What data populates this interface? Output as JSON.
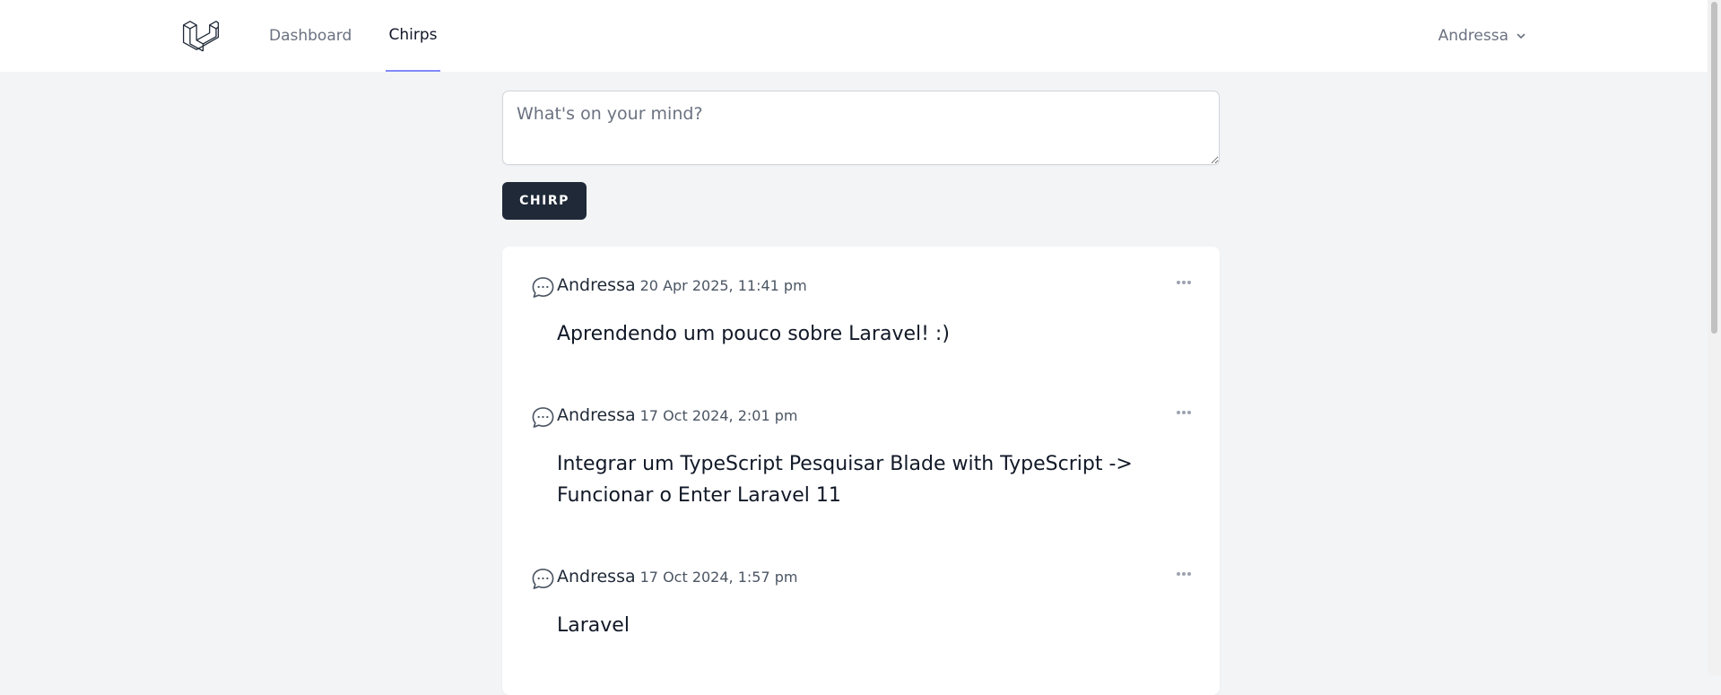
{
  "nav": {
    "links": [
      {
        "label": "Dashboard",
        "active": false
      },
      {
        "label": "Chirps",
        "active": true
      }
    ],
    "user_name": "Andressa"
  },
  "composer": {
    "placeholder": "What's on your mind?",
    "value": "",
    "button_label": "CHIRP"
  },
  "chirps": [
    {
      "author": "Andressa",
      "date": "20 Apr 2025, 11:41 pm",
      "message": "Aprendendo um pouco sobre Laravel! :)"
    },
    {
      "author": "Andressa",
      "date": "17 Oct 2024, 2:01 pm",
      "message": "Integrar um TypeScript Pesquisar Blade with TypeScript -> Funcionar o Enter Laravel 11"
    },
    {
      "author": "Andressa",
      "date": "17 Oct 2024, 1:57 pm",
      "message": "Laravel"
    }
  ],
  "colors": {
    "accent": "#818cf8",
    "button": "#1f2937",
    "background": "#f3f4f6"
  },
  "icons": {
    "logo": "laravel-logo-icon",
    "chirp": "chat-bubble-icon",
    "menu": "ellipsis-icon",
    "user_menu": "chevron-down-icon"
  }
}
